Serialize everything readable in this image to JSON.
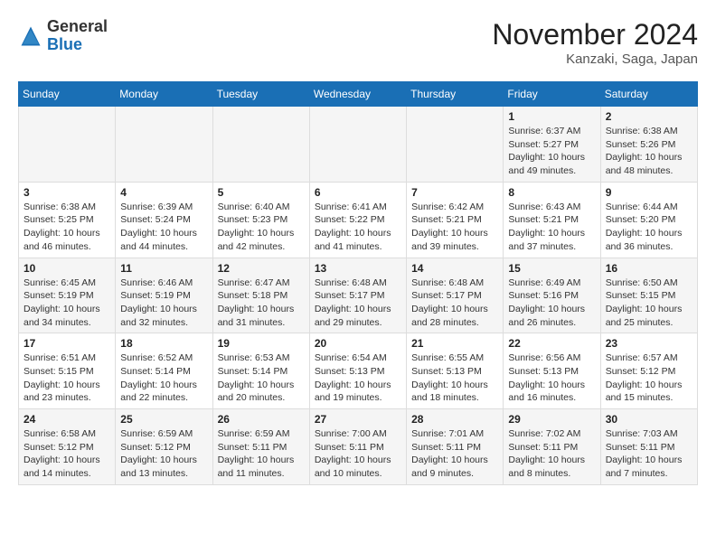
{
  "logo": {
    "general": "General",
    "blue": "Blue"
  },
  "header": {
    "month": "November 2024",
    "location": "Kanzaki, Saga, Japan"
  },
  "weekdays": [
    "Sunday",
    "Monday",
    "Tuesday",
    "Wednesday",
    "Thursday",
    "Friday",
    "Saturday"
  ],
  "weeks": [
    [
      {
        "day": "",
        "info": ""
      },
      {
        "day": "",
        "info": ""
      },
      {
        "day": "",
        "info": ""
      },
      {
        "day": "",
        "info": ""
      },
      {
        "day": "",
        "info": ""
      },
      {
        "day": "1",
        "info": "Sunrise: 6:37 AM\nSunset: 5:27 PM\nDaylight: 10 hours\nand 49 minutes."
      },
      {
        "day": "2",
        "info": "Sunrise: 6:38 AM\nSunset: 5:26 PM\nDaylight: 10 hours\nand 48 minutes."
      }
    ],
    [
      {
        "day": "3",
        "info": "Sunrise: 6:38 AM\nSunset: 5:25 PM\nDaylight: 10 hours\nand 46 minutes."
      },
      {
        "day": "4",
        "info": "Sunrise: 6:39 AM\nSunset: 5:24 PM\nDaylight: 10 hours\nand 44 minutes."
      },
      {
        "day": "5",
        "info": "Sunrise: 6:40 AM\nSunset: 5:23 PM\nDaylight: 10 hours\nand 42 minutes."
      },
      {
        "day": "6",
        "info": "Sunrise: 6:41 AM\nSunset: 5:22 PM\nDaylight: 10 hours\nand 41 minutes."
      },
      {
        "day": "7",
        "info": "Sunrise: 6:42 AM\nSunset: 5:21 PM\nDaylight: 10 hours\nand 39 minutes."
      },
      {
        "day": "8",
        "info": "Sunrise: 6:43 AM\nSunset: 5:21 PM\nDaylight: 10 hours\nand 37 minutes."
      },
      {
        "day": "9",
        "info": "Sunrise: 6:44 AM\nSunset: 5:20 PM\nDaylight: 10 hours\nand 36 minutes."
      }
    ],
    [
      {
        "day": "10",
        "info": "Sunrise: 6:45 AM\nSunset: 5:19 PM\nDaylight: 10 hours\nand 34 minutes."
      },
      {
        "day": "11",
        "info": "Sunrise: 6:46 AM\nSunset: 5:19 PM\nDaylight: 10 hours\nand 32 minutes."
      },
      {
        "day": "12",
        "info": "Sunrise: 6:47 AM\nSunset: 5:18 PM\nDaylight: 10 hours\nand 31 minutes."
      },
      {
        "day": "13",
        "info": "Sunrise: 6:48 AM\nSunset: 5:17 PM\nDaylight: 10 hours\nand 29 minutes."
      },
      {
        "day": "14",
        "info": "Sunrise: 6:48 AM\nSunset: 5:17 PM\nDaylight: 10 hours\nand 28 minutes."
      },
      {
        "day": "15",
        "info": "Sunrise: 6:49 AM\nSunset: 5:16 PM\nDaylight: 10 hours\nand 26 minutes."
      },
      {
        "day": "16",
        "info": "Sunrise: 6:50 AM\nSunset: 5:15 PM\nDaylight: 10 hours\nand 25 minutes."
      }
    ],
    [
      {
        "day": "17",
        "info": "Sunrise: 6:51 AM\nSunset: 5:15 PM\nDaylight: 10 hours\nand 23 minutes."
      },
      {
        "day": "18",
        "info": "Sunrise: 6:52 AM\nSunset: 5:14 PM\nDaylight: 10 hours\nand 22 minutes."
      },
      {
        "day": "19",
        "info": "Sunrise: 6:53 AM\nSunset: 5:14 PM\nDaylight: 10 hours\nand 20 minutes."
      },
      {
        "day": "20",
        "info": "Sunrise: 6:54 AM\nSunset: 5:13 PM\nDaylight: 10 hours\nand 19 minutes."
      },
      {
        "day": "21",
        "info": "Sunrise: 6:55 AM\nSunset: 5:13 PM\nDaylight: 10 hours\nand 18 minutes."
      },
      {
        "day": "22",
        "info": "Sunrise: 6:56 AM\nSunset: 5:13 PM\nDaylight: 10 hours\nand 16 minutes."
      },
      {
        "day": "23",
        "info": "Sunrise: 6:57 AM\nSunset: 5:12 PM\nDaylight: 10 hours\nand 15 minutes."
      }
    ],
    [
      {
        "day": "24",
        "info": "Sunrise: 6:58 AM\nSunset: 5:12 PM\nDaylight: 10 hours\nand 14 minutes."
      },
      {
        "day": "25",
        "info": "Sunrise: 6:59 AM\nSunset: 5:12 PM\nDaylight: 10 hours\nand 13 minutes."
      },
      {
        "day": "26",
        "info": "Sunrise: 6:59 AM\nSunset: 5:11 PM\nDaylight: 10 hours\nand 11 minutes."
      },
      {
        "day": "27",
        "info": "Sunrise: 7:00 AM\nSunset: 5:11 PM\nDaylight: 10 hours\nand 10 minutes."
      },
      {
        "day": "28",
        "info": "Sunrise: 7:01 AM\nSunset: 5:11 PM\nDaylight: 10 hours\nand 9 minutes."
      },
      {
        "day": "29",
        "info": "Sunrise: 7:02 AM\nSunset: 5:11 PM\nDaylight: 10 hours\nand 8 minutes."
      },
      {
        "day": "30",
        "info": "Sunrise: 7:03 AM\nSunset: 5:11 PM\nDaylight: 10 hours\nand 7 minutes."
      }
    ]
  ]
}
